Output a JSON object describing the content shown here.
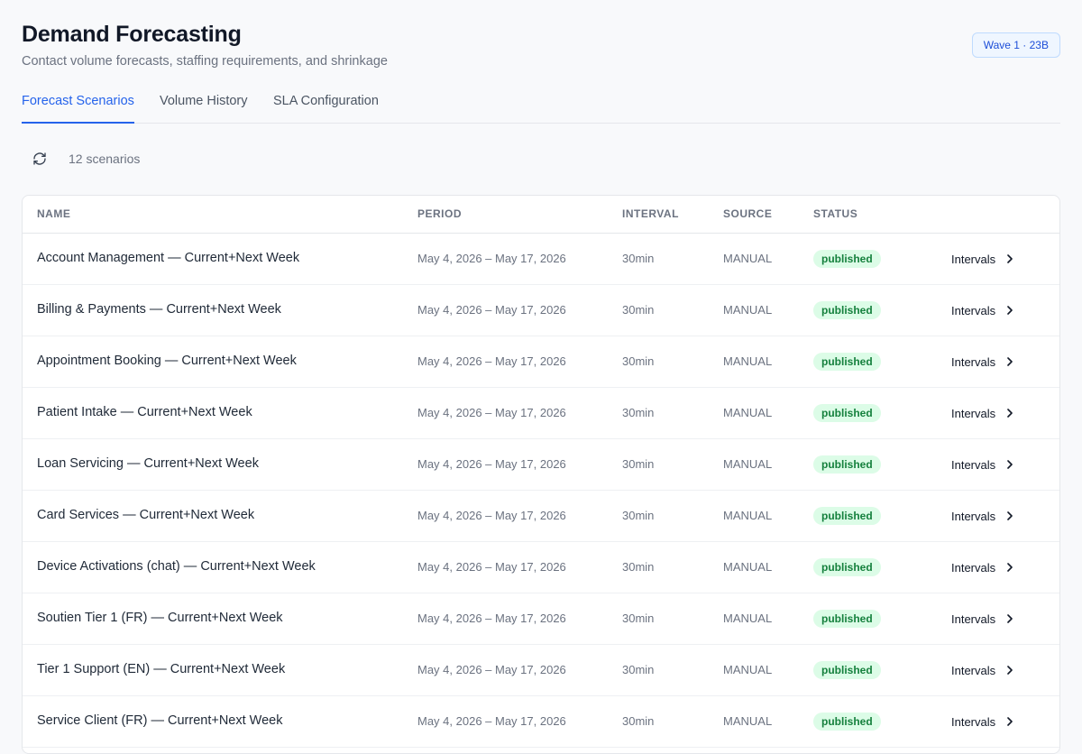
{
  "header": {
    "title": "Demand Forecasting",
    "subtitle": "Contact volume forecasts, staffing requirements, and shrinkage",
    "badge": "Wave 1 · 23B"
  },
  "tabs": [
    {
      "label": "Forecast Scenarios",
      "active": true
    },
    {
      "label": "Volume History",
      "active": false
    },
    {
      "label": "SLA Configuration",
      "active": false
    }
  ],
  "toolbar": {
    "refresh_icon": "refresh-icon",
    "count_label": "12 scenarios"
  },
  "table": {
    "columns": [
      "NAME",
      "PERIOD",
      "INTERVAL",
      "SOURCE",
      "STATUS"
    ],
    "rows": [
      {
        "name": "Account Management — Current+Next Week",
        "period": "May 4, 2026 – May 17, 2026",
        "interval": "30min",
        "source": "MANUAL",
        "status": "published",
        "action": "Intervals"
      },
      {
        "name": "Billing & Payments — Current+Next Week",
        "period": "May 4, 2026 – May 17, 2026",
        "interval": "30min",
        "source": "MANUAL",
        "status": "published",
        "action": "Intervals"
      },
      {
        "name": "Appointment Booking — Current+Next Week",
        "period": "May 4, 2026 – May 17, 2026",
        "interval": "30min",
        "source": "MANUAL",
        "status": "published",
        "action": "Intervals"
      },
      {
        "name": "Patient Intake — Current+Next Week",
        "period": "May 4, 2026 – May 17, 2026",
        "interval": "30min",
        "source": "MANUAL",
        "status": "published",
        "action": "Intervals"
      },
      {
        "name": "Loan Servicing — Current+Next Week",
        "period": "May 4, 2026 – May 17, 2026",
        "interval": "30min",
        "source": "MANUAL",
        "status": "published",
        "action": "Intervals"
      },
      {
        "name": "Card Services — Current+Next Week",
        "period": "May 4, 2026 – May 17, 2026",
        "interval": "30min",
        "source": "MANUAL",
        "status": "published",
        "action": "Intervals"
      },
      {
        "name": "Device Activations (chat) — Current+Next Week",
        "period": "May 4, 2026 – May 17, 2026",
        "interval": "30min",
        "source": "MANUAL",
        "status": "published",
        "action": "Intervals"
      },
      {
        "name": "Soutien Tier 1 (FR) — Current+Next Week",
        "period": "May 4, 2026 – May 17, 2026",
        "interval": "30min",
        "source": "MANUAL",
        "status": "published",
        "action": "Intervals"
      },
      {
        "name": "Tier 1 Support (EN) — Current+Next Week",
        "period": "May 4, 2026 – May 17, 2026",
        "interval": "30min",
        "source": "MANUAL",
        "status": "published",
        "action": "Intervals"
      },
      {
        "name": "Service Client (FR) — Current+Next Week",
        "period": "May 4, 2026 – May 17, 2026",
        "interval": "30min",
        "source": "MANUAL",
        "status": "published",
        "action": "Intervals"
      }
    ]
  },
  "colors": {
    "accent": "#2563eb",
    "status_published_bg": "#dcfce7",
    "status_published_text": "#15803d"
  }
}
